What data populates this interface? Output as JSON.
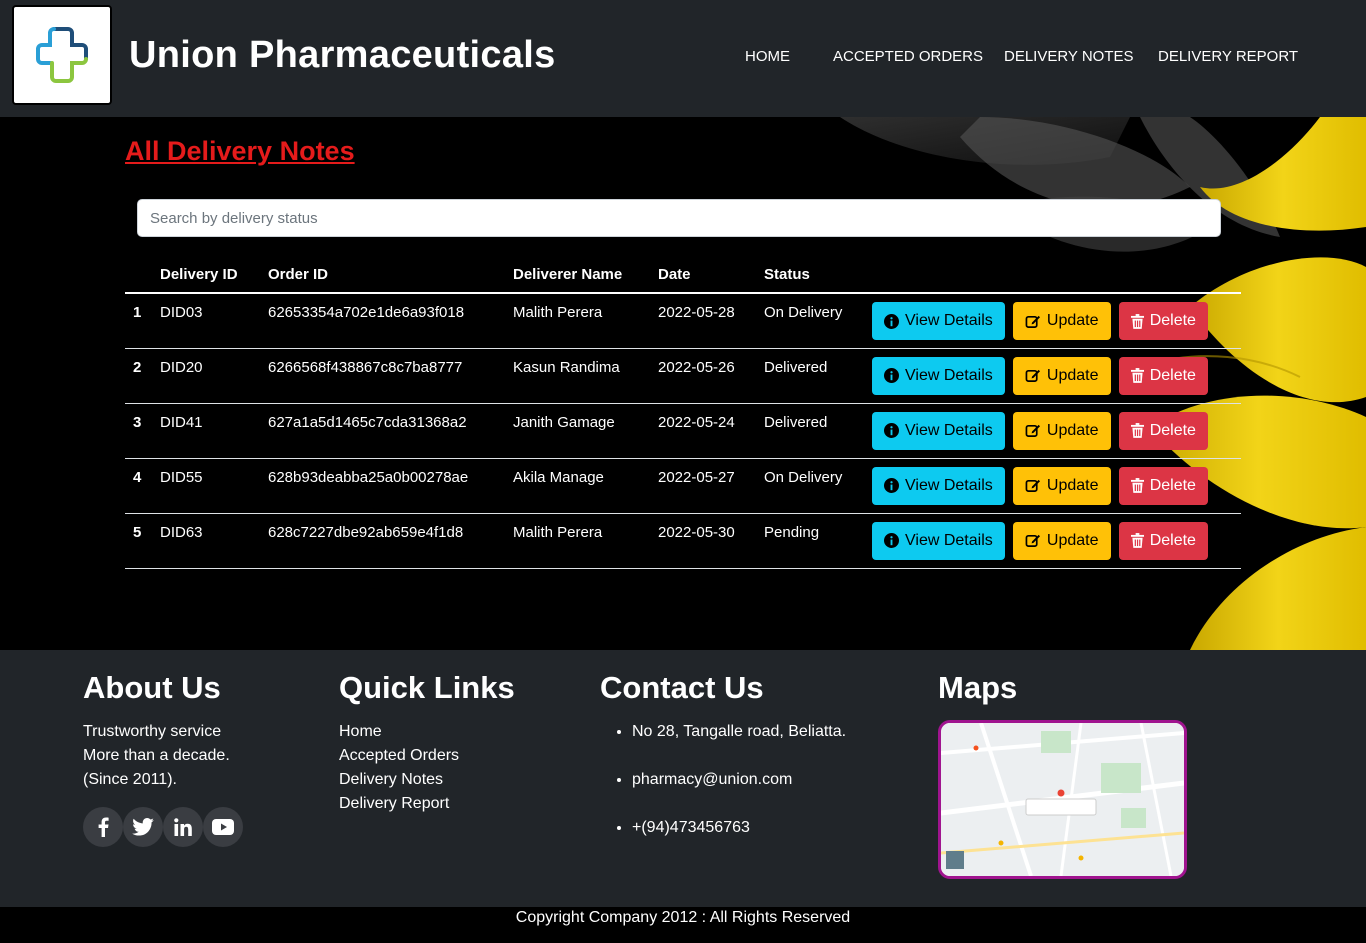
{
  "header": {
    "brand": "Union Pharmaceuticals",
    "nav": [
      "HOME",
      "ACCEPTED ORDERS",
      "DELIVERY NOTES",
      "DELIVERY REPORT"
    ]
  },
  "main": {
    "title": "All Delivery Notes",
    "search_placeholder": "Search by delivery status",
    "columns": [
      "",
      "Delivery ID",
      "Order ID",
      "Deliverer Name",
      "Date",
      "Status",
      ""
    ],
    "rows": [
      {
        "num": "1",
        "delivery_id": "DID03",
        "order_id": "62653354a702e1de6a93f018",
        "deliverer": "Malith Perera",
        "date": "2022-05-28",
        "status": "On Delivery"
      },
      {
        "num": "2",
        "delivery_id": "DID20",
        "order_id": "6266568f438867c8c7ba8777",
        "deliverer": "Kasun Randima",
        "date": "2022-05-26",
        "status": "Delivered"
      },
      {
        "num": "3",
        "delivery_id": "DID41",
        "order_id": "627a1a5d1465c7cda31368a2",
        "deliverer": "Janith Gamage",
        "date": "2022-05-24",
        "status": "Delivered"
      },
      {
        "num": "4",
        "delivery_id": "DID55",
        "order_id": "628b93deabba25a0b00278ae",
        "deliverer": "Akila Manage",
        "date": "2022-05-27",
        "status": "On Delivery"
      },
      {
        "num": "5",
        "delivery_id": "DID63",
        "order_id": "628c7227dbe92ab659e4f1d8",
        "deliverer": "Malith Perera",
        "date": "2022-05-30",
        "status": "Pending"
      }
    ],
    "actions": {
      "view": "View Details",
      "update": "Update",
      "delete": "Delete"
    }
  },
  "footer": {
    "about": {
      "title": "About Us",
      "lines": [
        "Trustworthy service",
        "More than a decade.",
        "(Since 2011)."
      ]
    },
    "socials": [
      "facebook-icon",
      "twitter-icon",
      "linkedin-icon",
      "youtube-icon"
    ],
    "quick_links": {
      "title": "Quick Links",
      "items": [
        "Home",
        "Accepted Orders",
        "Delivery Notes",
        "Delivery Report"
      ]
    },
    "contact": {
      "title": "Contact Us",
      "items": [
        "No 28, Tangalle road, Beliatta.",
        "pharmacy@union.com",
        "+(94)473456763"
      ]
    },
    "maps": {
      "title": "Maps"
    }
  },
  "copyright": "Copyright Company 2012 : All Rights Reserved",
  "colors": {
    "header_bg": "#212529",
    "title_red": "#e51b1b",
    "info": "#0dcaf0",
    "warning": "#ffc107",
    "danger": "#dc3545"
  }
}
